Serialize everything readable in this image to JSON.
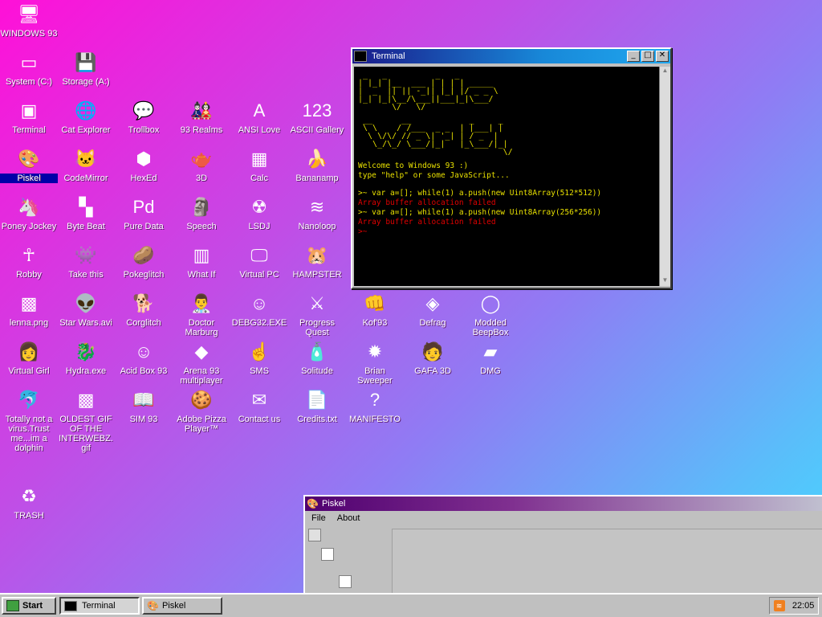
{
  "desktop": {
    "icons": [
      {
        "label": "WINDOWS 93",
        "glyph": "🖥"
      },
      {
        "label": "System (C:)",
        "glyph": "▭"
      },
      {
        "label": "Storage (A:)",
        "glyph": "💾"
      },
      {
        "label": "Terminal",
        "glyph": "▣"
      },
      {
        "label": "Cat Explorer",
        "glyph": "🌐"
      },
      {
        "label": "Trollbox",
        "glyph": "💬"
      },
      {
        "label": "93 Realms",
        "glyph": "🎎"
      },
      {
        "label": "ANSI Love",
        "glyph": "A"
      },
      {
        "label": "ASCII Gallery",
        "glyph": "123"
      },
      {
        "label": "Piskel",
        "glyph": "🎨"
      },
      {
        "label": "CodeMirror",
        "glyph": "🐱"
      },
      {
        "label": "HexEd",
        "glyph": "⬢"
      },
      {
        "label": "3D",
        "glyph": "🫖"
      },
      {
        "label": "Calc",
        "glyph": "▦"
      },
      {
        "label": "Bananamp",
        "glyph": "🍌"
      },
      {
        "label": "Poney Jockey",
        "glyph": "🦄"
      },
      {
        "label": "Byte Beat",
        "glyph": "▚"
      },
      {
        "label": "Pure Data",
        "glyph": "Pd"
      },
      {
        "label": "Speech",
        "glyph": "🗿"
      },
      {
        "label": "LSDJ",
        "glyph": "☢"
      },
      {
        "label": "Nanoloop",
        "glyph": "≋"
      },
      {
        "label": "Robby",
        "glyph": "☥"
      },
      {
        "label": "Take this",
        "glyph": "👾"
      },
      {
        "label": "Pokeglitch",
        "glyph": "🥔"
      },
      {
        "label": "What If",
        "glyph": "▥"
      },
      {
        "label": "Virtual PC",
        "glyph": "🖵"
      },
      {
        "label": "HAMPSTER",
        "glyph": "🐹"
      },
      {
        "label": "lenna.png",
        "glyph": "▩"
      },
      {
        "label": "Star Wars.avi",
        "glyph": "👽"
      },
      {
        "label": "Corglitch",
        "glyph": "🐕"
      },
      {
        "label": "Doctor Marburg",
        "glyph": "👨‍⚕"
      },
      {
        "label": "DEBG32.EXE",
        "glyph": "☺"
      },
      {
        "label": "Progress Quest",
        "glyph": "⚔"
      },
      {
        "label": "Kof'93",
        "glyph": "👊"
      },
      {
        "label": "Defrag",
        "glyph": "◈"
      },
      {
        "label": "Modded BeepBox",
        "glyph": "◯"
      },
      {
        "label": "Virtual Girl",
        "glyph": "👩"
      },
      {
        "label": "Hydra.exe",
        "glyph": "🐉"
      },
      {
        "label": "Acid Box 93",
        "glyph": "☺"
      },
      {
        "label": "Arena 93 multiplayer",
        "glyph": "◆"
      },
      {
        "label": "SMS",
        "glyph": "☝"
      },
      {
        "label": "Solitude",
        "glyph": "🧴"
      },
      {
        "label": "Brian Sweeper",
        "glyph": "✹"
      },
      {
        "label": "GAFA 3D",
        "glyph": "🧑"
      },
      {
        "label": "DMG",
        "glyph": "▰"
      },
      {
        "label": "Totally not a virus.Trust me...im a dolphin",
        "glyph": "🐬"
      },
      {
        "label": "OLDEST GIF OF THE INTERWEBZ.gif",
        "glyph": "▩"
      },
      {
        "label": "SIM 93",
        "glyph": "📖"
      },
      {
        "label": "Adobe Pizza Player™",
        "glyph": "🍪"
      },
      {
        "label": "Contact us",
        "glyph": "✉"
      },
      {
        "label": "Credits.txt",
        "glyph": "📄"
      },
      {
        "label": "MANIFESTO",
        "glyph": "?"
      },
      {
        "label": "TRASH",
        "glyph": "♻"
      }
    ]
  },
  "terminal": {
    "title": "Terminal",
    "ascii_line1": " _   _          _   _           \n| |_| |__  ___ | | | | _____    \n|  _  || || -_|| |_| |/ _ _ \\   \n|_| |_|\\__/\\___||___|_|\\___/   \n       \\/   \\/                ",
    "ascii_line2": " __      __            _     _ \n \\ \\    / /___  _ _  | |___| |\n  \\ \\/\\/ // _ \\| '_| | / _  | \n   \\_/\\_/ \\___/|_|   |_\\___/|_|\n                              \\/",
    "welcome": "Welcome to Windows 93 :)",
    "hint": "type \"help\" or some JavaScript...",
    "cmd1": ">~ var a=[]; while(1) a.push(new Uint8Array(512*512))",
    "err1": "Array buffer allocation failed",
    "cmd2": ">~ var a=[]; while(1) a.push(new Uint8Array(256*256))",
    "err2": "Array buffer allocation failed",
    "prompt": ">~"
  },
  "piskel": {
    "title": "Piskel",
    "menu_file": "File",
    "menu_about": "About"
  },
  "taskbar": {
    "start": "Start",
    "task_terminal": "Terminal",
    "task_piskel": "Piskel",
    "clock": "22:05"
  },
  "colors": {
    "title_active_start": "#000080",
    "title_active_end": "#1084d0",
    "terminal_text": "#e8e000",
    "terminal_error": "#e00000"
  }
}
